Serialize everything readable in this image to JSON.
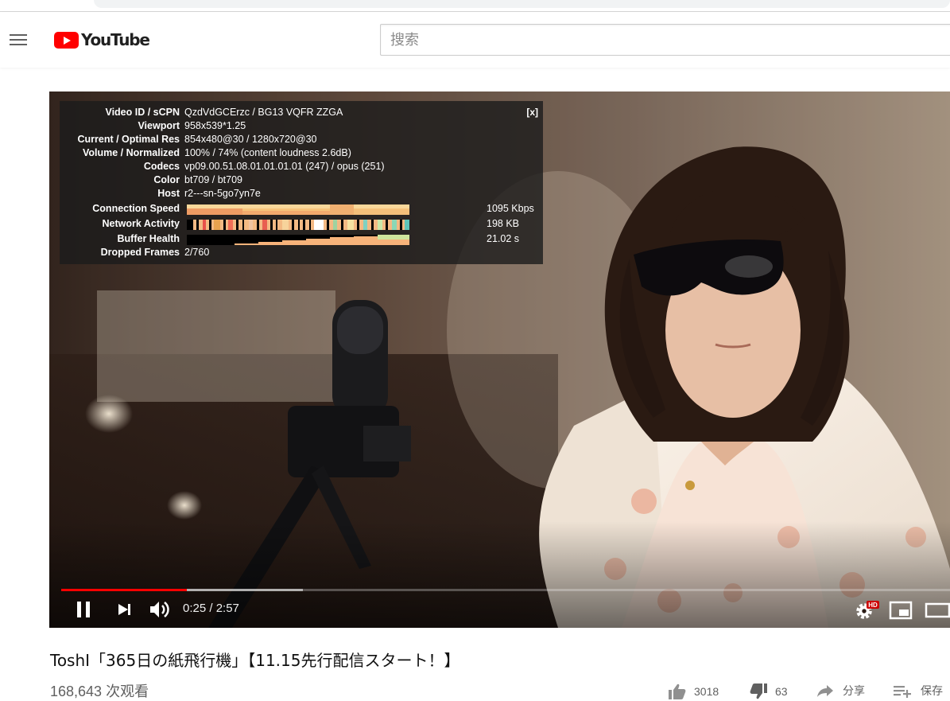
{
  "masthead": {
    "logo_text": "YouTube",
    "search_placeholder": "搜索"
  },
  "stats_overlay": {
    "close_label": "[x]",
    "rows": [
      {
        "label": "Video ID / sCPN",
        "value": "QzdVdGCErzc / BG13 VQFR ZZGA"
      },
      {
        "label": "Viewport",
        "value": "958x539*1.25"
      },
      {
        "label": "Current / Optimal Res",
        "value": "854x480@30 / 1280x720@30"
      },
      {
        "label": "Volume / Normalized",
        "value": "100% / 74% (content loudness 2.6dB)"
      },
      {
        "label": "Codecs",
        "value": "vp09.00.51.08.01.01.01.01 (247) / opus (251)"
      },
      {
        "label": "Color",
        "value": "bt709 / bt709"
      },
      {
        "label": "Host",
        "value": "r2---sn-5go7yn7e"
      }
    ],
    "graphs": [
      {
        "label": "Connection Speed",
        "value": "1095 Kbps"
      },
      {
        "label": "Network Activity",
        "value": "198 KB"
      },
      {
        "label": "Buffer Health",
        "value": "21.02 s"
      }
    ],
    "dropped": {
      "label": "Dropped Frames",
      "value": "2/760"
    }
  },
  "player": {
    "current_time": "0:25",
    "duration": "2:57",
    "time_display": "0:25 / 2:57",
    "played_fraction": 0.141,
    "buffered_fraction": 0.272,
    "hd_badge": "HD",
    "icons": [
      "pause-icon",
      "next-icon",
      "volume-icon",
      "settings-icon",
      "miniplayer-icon",
      "theater-icon"
    ]
  },
  "video": {
    "title": "ToshI「365日の紙飛行機」【11.15先行配信スタート！】",
    "views": "168,643 次观看",
    "likes": "3018",
    "dislikes": "63",
    "share_label": "分享",
    "save_label": "保存"
  },
  "colors": {
    "brand_red": "#ff0000",
    "progress_red": "#ff0000",
    "stats_bg": "#1c1c1c"
  }
}
